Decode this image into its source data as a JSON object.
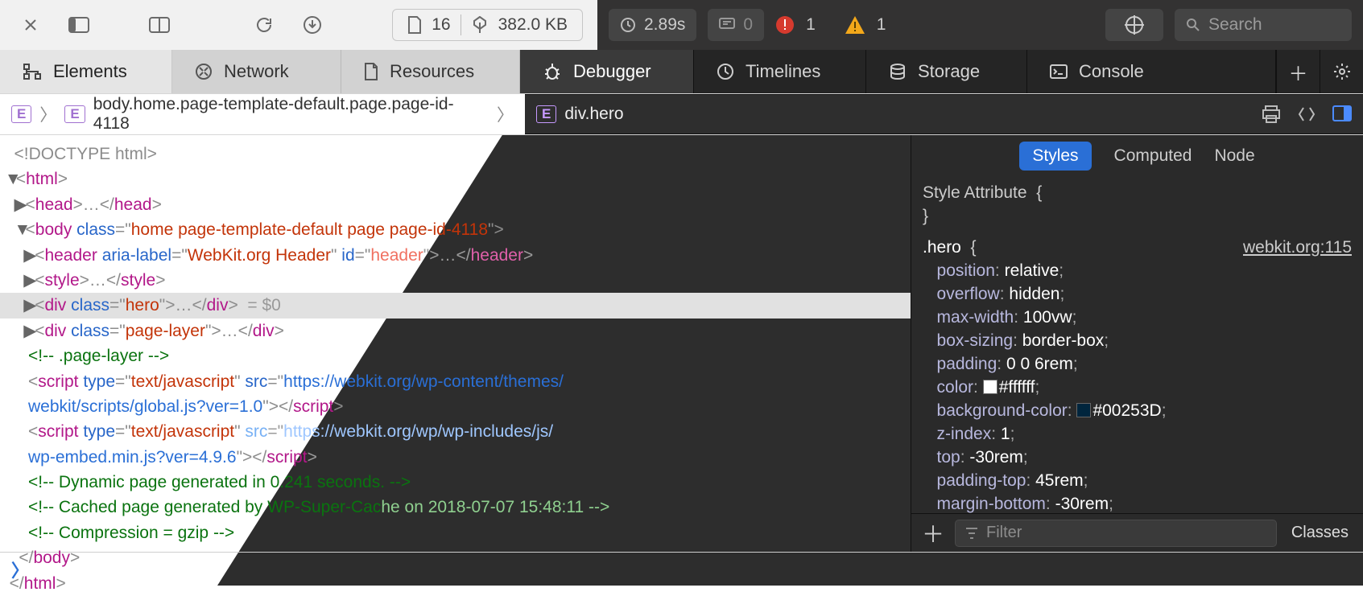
{
  "toolbar": {
    "fileCount": "16",
    "fileSize": "382.0 KB",
    "loadTime": "2.89s",
    "logs": "0",
    "errors": "1",
    "warnings": "1",
    "searchPlaceholder": "Search"
  },
  "tabs": [
    "Elements",
    "Network",
    "Resources",
    "Debugger",
    "Timelines",
    "Storage",
    "Console"
  ],
  "breadcrumb": {
    "a": "body.home.page-template-default.page.page-id-4118",
    "b": "div.hero"
  },
  "dom": {
    "doctype": "<!DOCTYPE html>",
    "html": "html",
    "head": "head",
    "bodyTag": "body",
    "bodyClass": "home page-template-default page page-id-4118",
    "headerTag": "header",
    "headerAria": "aria-label",
    "headerAriaV": "WebKit.org Header",
    "headerId": "id",
    "headerIdV": "header",
    "style": "style",
    "divHero": "div",
    "divHeroClass": "hero",
    "eq": "= $0",
    "divPage": "div",
    "divPageClass": "page-layer",
    "c1": "<!-- .page-layer -->",
    "scriptTag": "script",
    "typeAttr": "type",
    "typeV": "text/javascript",
    "srcAttr": "src",
    "src1": "https://webkit.org/wp-content/themes/webkit/scripts/global.js?ver=1.0",
    "src2": "https://webkit.org/wp/wp-includes/js/wp-embed.min.js?ver=4.9.6",
    "c2": "<!-- Dynamic page generated in 0.241 seconds. -->",
    "c3": "<!-- Cached page generated by WP-Super-Cache on 2018-07-07 15:48:11 -->",
    "c4": "<!-- Compression = gzip -->"
  },
  "stylesPane": {
    "tabs": [
      "Styles",
      "Computed",
      "Node"
    ],
    "sa": "Style Attribute",
    "rule": ".hero",
    "src": "webkit.org:115",
    "props": [
      {
        "n": "position",
        "v": "relative"
      },
      {
        "n": "overflow",
        "v": "hidden"
      },
      {
        "n": "max-width",
        "v": "100vw"
      },
      {
        "n": "box-sizing",
        "v": "border-box"
      },
      {
        "n": "padding",
        "v": "0 0 6rem"
      },
      {
        "n": "color",
        "v": "#ffffff",
        "sw": "#ffffff"
      },
      {
        "n": "background-color",
        "v": "#00253D",
        "sw": "#00253D"
      },
      {
        "n": "z-index",
        "v": "1"
      },
      {
        "n": "top",
        "v": "-30rem"
      },
      {
        "n": "padding-top",
        "v": "45rem"
      },
      {
        "n": "margin-bottom",
        "v": "-30rem"
      }
    ],
    "filter": "Filter",
    "classes": "Classes"
  }
}
